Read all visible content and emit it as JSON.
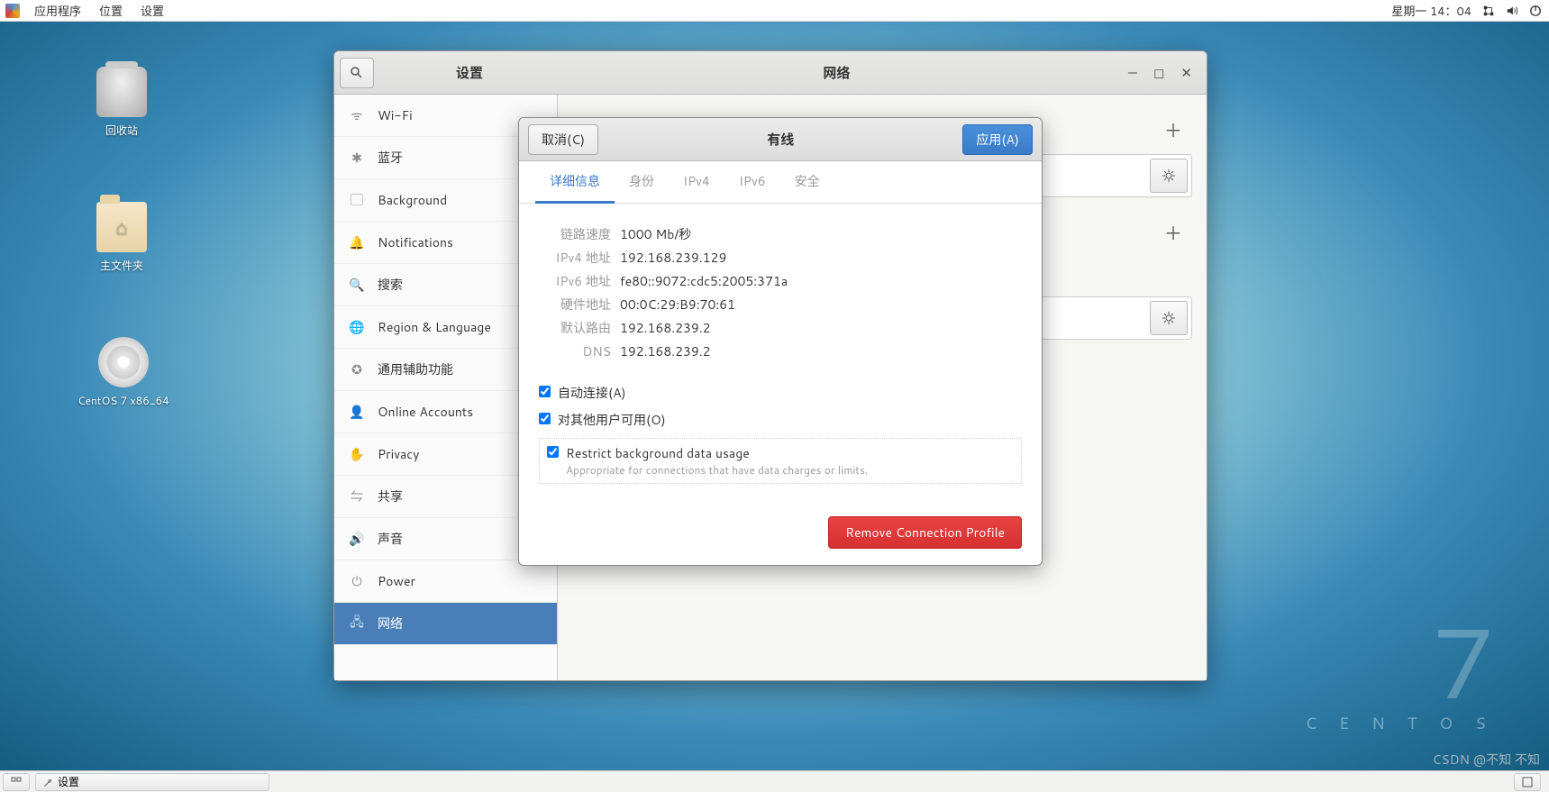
{
  "menubar": {
    "apps": "应用程序",
    "places": "位置",
    "settings": "设置",
    "clock": "星期一 14：04"
  },
  "desktop": {
    "trash": "回收站",
    "home": "主文件夹",
    "disc": "CentOS 7 x86_64"
  },
  "wallpaper": {
    "num": "7",
    "name": "C E N T O S"
  },
  "window": {
    "title_left": "设置",
    "title_center": "网络",
    "sidebar": [
      {
        "icon": "wifi",
        "label": "Wi-Fi"
      },
      {
        "icon": "bt",
        "label": "蓝牙"
      },
      {
        "icon": "bg",
        "label": "Background"
      },
      {
        "icon": "bell",
        "label": "Notifications"
      },
      {
        "icon": "search",
        "label": "搜索"
      },
      {
        "icon": "globe",
        "label": "Region & Language"
      },
      {
        "icon": "access",
        "label": "通用辅助功能"
      },
      {
        "icon": "cloud",
        "label": "Online Accounts"
      },
      {
        "icon": "privacy",
        "label": "Privacy"
      },
      {
        "icon": "share",
        "label": "共享"
      },
      {
        "icon": "sound",
        "label": "声音"
      },
      {
        "icon": "power",
        "label": "Power"
      },
      {
        "icon": "net",
        "label": "网络",
        "active": true
      }
    ]
  },
  "dialog": {
    "cancel": "取消(C)",
    "apply": "应用(A)",
    "title": "有线",
    "tabs": [
      "详细信息",
      "身份",
      "IPv4",
      "IPv6",
      "安全"
    ],
    "info": {
      "link_speed_label": "链路速度",
      "link_speed": "1000 Mb/秒",
      "ipv4_label": "IPv4 地址",
      "ipv4": "192.168.239.129",
      "ipv6_label": "IPv6 地址",
      "ipv6": "fe80::9072:cdc5:2005:371a",
      "hw_label": "硬件地址",
      "hw": "00:0C:29:B9:70:61",
      "route_label": "默认路由",
      "route": "192.168.239.2",
      "dns_label": "DNS",
      "dns": "192.168.239.2"
    },
    "auto_connect": "自动连接(A)",
    "avail_others": "对其他用户可用(O)",
    "restrict": "Restrict background data usage",
    "restrict_sub": "Appropriate for connections that have data charges or limits.",
    "remove": "Remove Connection Profile"
  },
  "taskbar": {
    "settings": "设置"
  },
  "watermark": "CSDN @不知 不知"
}
